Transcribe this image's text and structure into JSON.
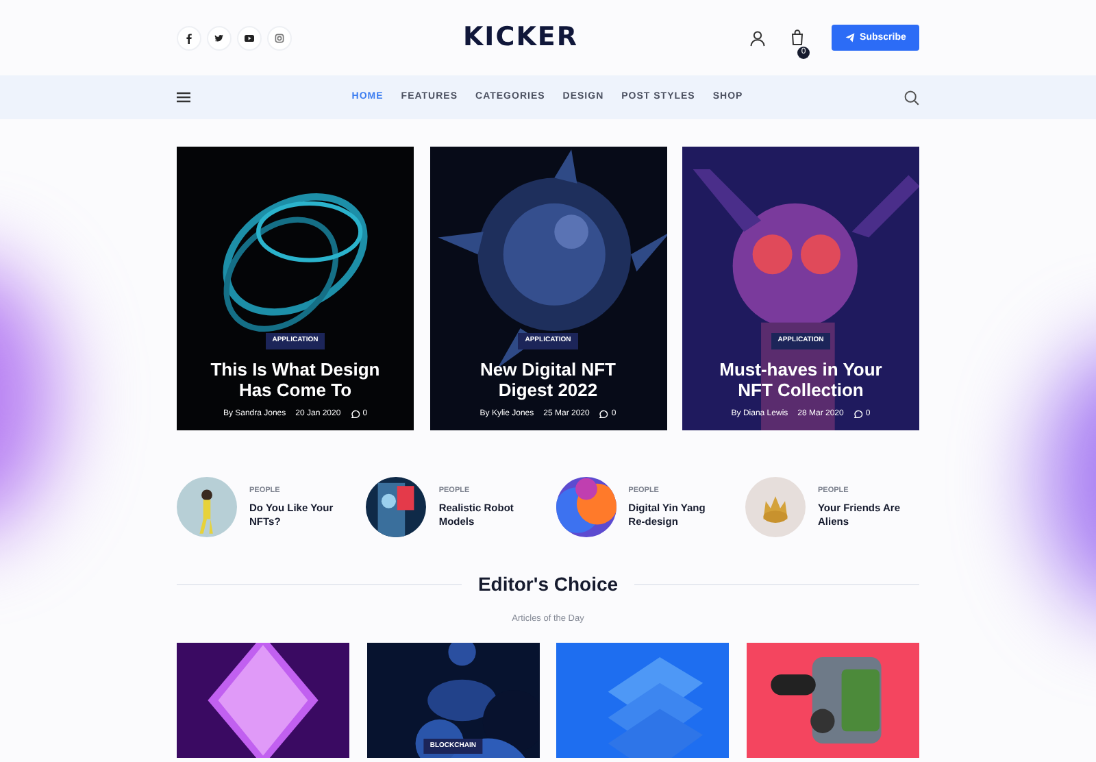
{
  "header": {
    "social": [
      {
        "kind": "facebook"
      },
      {
        "kind": "twitter"
      },
      {
        "kind": "youtube"
      },
      {
        "kind": "instagram"
      }
    ],
    "logo": "KICKER",
    "cart_count": "0",
    "subscribe": "Subscribe"
  },
  "nav": [
    {
      "label": "HOME",
      "selected": true
    },
    {
      "label": "FEATURES",
      "selected": false
    },
    {
      "label": "CATEGORIES",
      "selected": false
    },
    {
      "label": "DESIGN",
      "selected": false
    },
    {
      "label": "POST STYLES",
      "selected": false
    },
    {
      "label": "SHOP",
      "selected": false
    }
  ],
  "featured": [
    {
      "category": "APPLICATION",
      "title": "This Is What Design Has Come To",
      "author": "By Sandra Jones",
      "date": "20 Jan 2020",
      "comments": "0"
    },
    {
      "category": "APPLICATION",
      "title": "New Digital NFT Digest 2022",
      "author": "By Kylie Jones",
      "date": "25 Mar 2020",
      "comments": "0"
    },
    {
      "category": "APPLICATION",
      "title": "Must-haves in Your NFT Collection",
      "author": "By Diana Lewis",
      "date": "28 Mar 2020",
      "comments": "0"
    }
  ],
  "small_posts": [
    {
      "category": "PEOPLE",
      "title": "Do You Like Your NFTs?"
    },
    {
      "category": "PEOPLE",
      "title": "Realistic Robot Models"
    },
    {
      "category": "PEOPLE",
      "title": "Digital Yin Yang Re-design"
    },
    {
      "category": "PEOPLE",
      "title": "Your Friends Are Aliens"
    }
  ],
  "editors_choice": {
    "title": "Editor's Choice",
    "subtitle": "Articles of the Day",
    "posts": [
      {
        "kind": "picture"
      },
      {
        "kind": "picture",
        "category": "BLOCKCHAIN"
      },
      {
        "kind": "picture"
      },
      {
        "kind": "picture"
      }
    ]
  }
}
